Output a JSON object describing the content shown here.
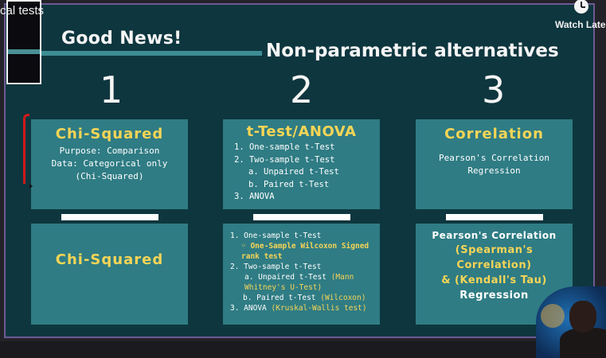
{
  "video": {
    "title_fragment": "cal tests",
    "watch_later_label": "Watch Later"
  },
  "slide": {
    "good_news": "Good News!",
    "heading": "Non-parametric alternatives",
    "numbers": [
      "1",
      "2",
      "3"
    ],
    "top_cards": [
      {
        "title": "Chi-Squared",
        "lines": [
          "Purpose: Comparison",
          "Data: Categorical only",
          "(Chi-Squared)"
        ]
      },
      {
        "title": "t-Test/ANOVA",
        "lines": [
          "1. One-sample t-Test",
          "2. Two-sample t-Test",
          "a. Unpaired t-Test",
          "b. Paired t-Test",
          "3. ANOVA"
        ]
      },
      {
        "title": "Correlation",
        "lines": [
          "Pearson's Correlation",
          "Regression"
        ]
      }
    ],
    "bottom_cards": [
      {
        "title": "Chi-Squared"
      },
      {
        "items": [
          {
            "text": "1. One-sample t-Test",
            "alt": ""
          },
          {
            "text": "",
            "alt": "◦ One-Sample Wilcoxon Signed rank test"
          },
          {
            "text": "2. Two-sample t-Test",
            "alt": ""
          },
          {
            "text": "a. Unpaired t-Test",
            "alt": "(Mann Whitney's U-Test)"
          },
          {
            "text": "b. Paired t-Test",
            "alt": "(Wilcoxon)"
          },
          {
            "text": "3. ANOVA",
            "alt": "(Kruskal-Wallis test)"
          }
        ]
      },
      {
        "line1": "Pearson's Correlation",
        "line2": "(Spearman's Correlation)",
        "line3": "& (Kendall's Tau)",
        "line4": "Regression"
      }
    ]
  },
  "colors": {
    "background": "#0e363e",
    "card": "#2f7c84",
    "title_yellow": "#f7d556",
    "accent_line": "#3e8d95"
  }
}
